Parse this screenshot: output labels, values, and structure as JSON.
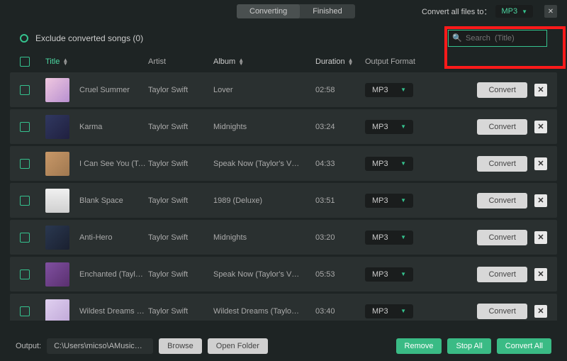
{
  "tabs": {
    "converting": "Converting",
    "finished": "Finished"
  },
  "convert_all_label": "Convert all files to：",
  "convert_all_format": "MP3",
  "exclude_label": "Exclude converted songs (0)",
  "search": {
    "placeholder": "Search  (Title)"
  },
  "columns": {
    "title": "Title",
    "artist": "Artist",
    "album": "Album",
    "duration": "Duration",
    "format": "Output Format"
  },
  "rows": [
    {
      "title": "Cruel Summer",
      "artist": "Taylor Swift",
      "album": "Lover",
      "duration": "02:58",
      "format": "MP3",
      "cover": "c1"
    },
    {
      "title": "Karma",
      "artist": "Taylor Swift",
      "album": "Midnights",
      "duration": "03:24",
      "format": "MP3",
      "cover": "c2"
    },
    {
      "title": "I Can See You (Tay…",
      "artist": "Taylor Swift",
      "album": "Speak Now (Taylor's V…",
      "duration": "04:33",
      "format": "MP3",
      "cover": "c3"
    },
    {
      "title": "Blank Space",
      "artist": "Taylor Swift",
      "album": "1989 (Deluxe)",
      "duration": "03:51",
      "format": "MP3",
      "cover": "c4"
    },
    {
      "title": "Anti-Hero",
      "artist": "Taylor Swift",
      "album": "Midnights",
      "duration": "03:20",
      "format": "MP3",
      "cover": "c5"
    },
    {
      "title": "Enchanted (Taylor'…",
      "artist": "Taylor Swift",
      "album": "Speak Now (Taylor's V…",
      "duration": "05:53",
      "format": "MP3",
      "cover": "c6"
    },
    {
      "title": "Wildest Dreams (T…",
      "artist": "Taylor Swift",
      "album": "Wildest Dreams (Taylo…",
      "duration": "03:40",
      "format": "MP3",
      "cover": "c7"
    }
  ],
  "convert_label": "Convert",
  "output": {
    "label": "Output:",
    "path": "C:\\Users\\micso\\AMusicSoft\\…",
    "browse": "Browse",
    "open": "Open Folder"
  },
  "footer_buttons": {
    "remove": "Remove",
    "stop": "Stop All",
    "convert_all": "Convert All"
  }
}
